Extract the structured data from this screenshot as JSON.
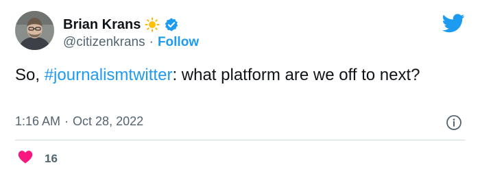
{
  "author": {
    "display_name": "Brian Krans",
    "name_emoji_icon": "sun-icon",
    "verified_icon": "verified-badge-icon",
    "handle": "@citizenkrans",
    "separator": "·",
    "follow_label": "Follow"
  },
  "tweet": {
    "text_prefix": "So, ",
    "hashtag": "#journalismtwitter",
    "text_suffix": ": what platform are we off to next?"
  },
  "meta": {
    "time": "1:16 AM",
    "separator": "·",
    "date": "Oct 28, 2022"
  },
  "engagement": {
    "likes": "16",
    "like_icon": "heart-icon"
  },
  "icons": {
    "logo": "twitter-bird-icon",
    "info": "info-icon"
  },
  "colors": {
    "accent": "#1d9bf0",
    "text": "#0f1419",
    "secondary": "#536471",
    "like": "#f91880",
    "divider": "#cfd9de"
  }
}
